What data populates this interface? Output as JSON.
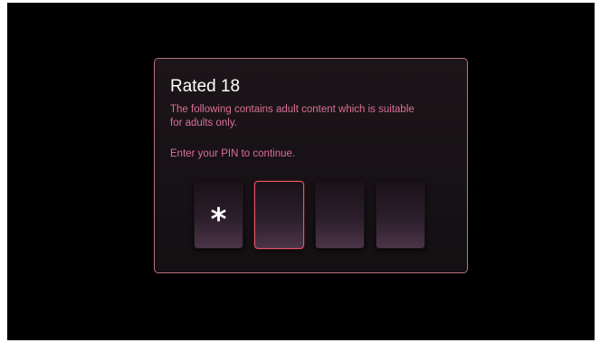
{
  "dialog": {
    "title": "Rated 18",
    "message": "The following contains adult content which is suitable for adults only.",
    "prompt": "Enter your PIN to continue."
  },
  "pin": {
    "digits": [
      "*",
      "",
      "",
      ""
    ],
    "active_index": 1
  },
  "colors": {
    "background": "#000000",
    "dialog_border": "#b9737f",
    "message_text": "#db6f95",
    "active_border": "#e4576a"
  }
}
